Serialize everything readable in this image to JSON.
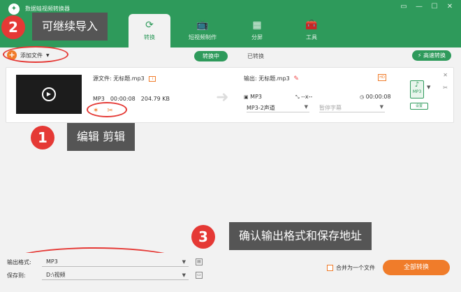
{
  "app": {
    "title": "数据蛙视频转换器",
    "window_controls": [
      "▭",
      "—",
      "☐",
      "✕"
    ]
  },
  "nav": {
    "tabs": [
      {
        "label": "转换",
        "icon": "convert-icon",
        "glyph": "⟳",
        "active": true
      },
      {
        "label": "短视频制作",
        "icon": "tv-icon",
        "glyph": "📺",
        "active": false
      },
      {
        "label": "分屏",
        "icon": "split-screen-icon",
        "glyph": "▦",
        "active": false
      },
      {
        "label": "工具",
        "icon": "toolbox-icon",
        "glyph": "🧰",
        "active": false
      }
    ]
  },
  "toolbar": {
    "add_file_label": "添加文件",
    "add_file_caret": "▼",
    "converting_label": "转换中",
    "converted_label": "已转换",
    "fast_convert_label": "高速转换"
  },
  "file": {
    "source_label": "源文件:",
    "source_name": "无标题.mp3",
    "format": "MP3",
    "duration": "00:00:08",
    "size": "204.79 KB",
    "output_label": "输出:",
    "output_name": "无标题.mp3",
    "out_format": "MP3",
    "out_resolution": "--x--",
    "out_duration": "00:00:08",
    "channel_select": "MP3-2声道",
    "subtitle_select": "暂停字幕",
    "settings_label": "设置",
    "format_icon_text": "MP3"
  },
  "callouts": {
    "one": {
      "number": "1",
      "text": "编辑 剪辑"
    },
    "two": {
      "number": "2",
      "text": "可继续导入"
    },
    "three": {
      "number": "3",
      "text": "确认输出格式和保存地址"
    }
  },
  "bottom": {
    "output_format_label": "输出格式:",
    "output_format_value": "MP3",
    "save_to_label": "保存到:",
    "save_to_value": "D:\\视频",
    "merge_label": "合并为一个文件",
    "convert_all_label": "全部转换"
  },
  "colors": {
    "brand_green": "#2e9a5b",
    "accent_orange": "#f07c2a",
    "callout_red": "#e53935"
  }
}
